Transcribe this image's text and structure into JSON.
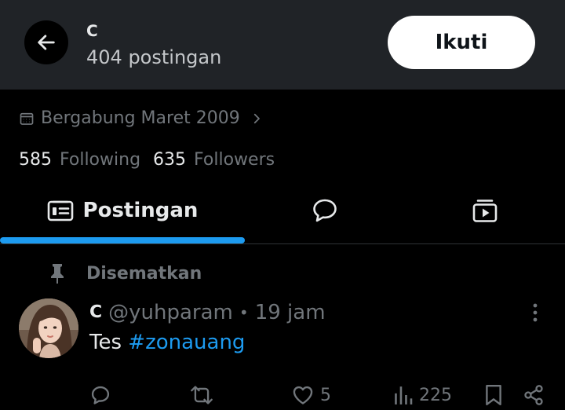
{
  "header": {
    "name": "ꓚ",
    "post_count": "404 postingan",
    "follow_label": "Ikuti"
  },
  "profile": {
    "joined": "Bergabung Maret 2009",
    "following_count": "585",
    "following_label": "Following",
    "followers_count": "635",
    "followers_label": "Followers"
  },
  "tabs": {
    "posts_label": "Postingan",
    "active_tab": "Postingan"
  },
  "pinned_label": "Disematkan",
  "post": {
    "author_name": "ꓚ",
    "handle": "@yuhparam",
    "separator": "•",
    "time": "19 jam",
    "text_prefix": "Tes ",
    "hashtag": "#zonauang",
    "like_count": "5",
    "view_count": "225"
  },
  "colors": {
    "accent": "#1d9bf0",
    "header_bg": "#202327",
    "background": "#000000",
    "muted_text": "#71767b"
  },
  "icons": {
    "back": "arrow-left-icon",
    "calendar": "calendar-icon",
    "chevron": "chevron-right-icon",
    "posts_tab": "posts-icon",
    "replies_tab": "speech-bubble-icon",
    "media_tab": "media-icon",
    "pin": "pin-icon",
    "more": "more-vertical-icon",
    "reply": "reply-icon",
    "repost": "repost-icon",
    "like": "heart-icon",
    "views": "bar-chart-icon",
    "bookmark": "bookmark-icon",
    "share": "share-icon"
  }
}
